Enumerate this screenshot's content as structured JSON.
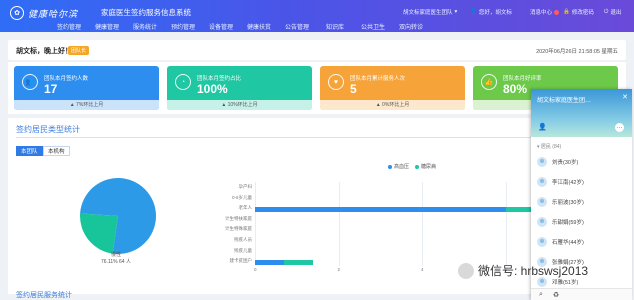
{
  "header": {
    "logo_text": "健康哈尔滨",
    "system_title": "家庭医生签约服务信息系统",
    "nav": [
      "签约管理",
      "健康管理",
      "服务统计",
      "预约管理",
      "设备管理",
      "健康扶贫",
      "公告管理",
      "知识库",
      "公共卫生",
      "双向转诊"
    ],
    "team_label": "胡文标家庭医生团队",
    "greeting_user": "您好，胡文标",
    "messages_label": "消息中心",
    "password_label": "修改密码",
    "logout_label": "退出"
  },
  "welcome": {
    "greeting": "胡文标，晚上好！",
    "role_badge": "团队长",
    "datetime": "2020年06月26日 21:58:05 星期五"
  },
  "stats": [
    {
      "label": "团队本月签约人数",
      "value": "17",
      "footer": "7%环比上月",
      "color": "#2d8ef0",
      "icon": "users-icon"
    },
    {
      "label": "团队本月签约占比",
      "value": "100%",
      "footer": "10%环比上月",
      "color": "#1fc7a2",
      "icon": "pie-chart-icon"
    },
    {
      "label": "团队本月累计服务人次",
      "value": "5",
      "footer": "0%环比上月",
      "color": "#f6a43a",
      "icon": "heart-icon"
    },
    {
      "label": "团队本月好评率",
      "value": "80%",
      "footer": "",
      "color": "#6cc94a",
      "icon": "thumbs-up-icon"
    }
  ],
  "section": {
    "title": "签约居民类型统计",
    "tabs": [
      "本团队",
      "本机构"
    ],
    "pie_label": "慢性",
    "pie_note": "76.11% 64 人",
    "legend": [
      {
        "name": "高血压",
        "color": "#2d8ef0"
      },
      {
        "name": "糖尿病",
        "color": "#1fc7a2"
      }
    ],
    "next_title": "签约居民服务统计"
  },
  "chart_data": [
    {
      "type": "pie",
      "slices": [
        {
          "label": "慢性",
          "value": 76.11,
          "color": "#2d9ae8"
        },
        {
          "label": "",
          "value": 23.89,
          "color": "#18c59b"
        }
      ]
    },
    {
      "type": "bar",
      "categories": [
        "孕产妇",
        "0-6岁儿童",
        "老年人",
        "计生特扶家庭",
        "计生特殊家庭",
        "残疾人员",
        "残疾儿童",
        "建卡贫困户"
      ],
      "series": [
        {
          "name": "高血压",
          "values": [
            0,
            0,
            6,
            0,
            0,
            0,
            0,
            0.7
          ],
          "color": "#2d8ef0"
        },
        {
          "name": "糖尿病",
          "values": [
            0,
            0,
            2,
            0,
            0,
            0,
            0,
            0.7
          ],
          "color": "#1fc7a2"
        }
      ],
      "xticks": [
        "0",
        "2",
        "4",
        "6",
        "8"
      ],
      "xlim": [
        0,
        8
      ]
    }
  ],
  "chat": {
    "team_name": "胡文标家庭医生团…",
    "group_label": "居民 (84)",
    "contacts": [
      "刘贵(30岁)",
      "李江南(42岁)",
      "乐丽波(30岁)",
      "乐甜娟(59岁)",
      "石雁华(44岁)",
      "张雅娟(27岁)",
      "邓雅(51岁)"
    ]
  },
  "watermark": "微信号: hrbswsj2013"
}
